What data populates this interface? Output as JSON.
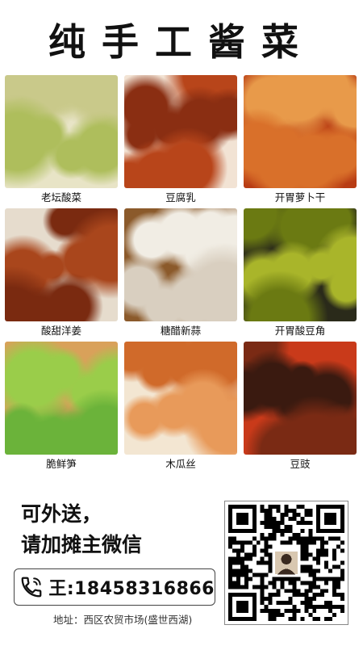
{
  "title": "纯手工酱菜",
  "items": [
    {
      "name": "老坛酸菜",
      "colors": [
        "#c9c98a",
        "#aebe5c",
        "#e8e4c6"
      ]
    },
    {
      "name": "豆腐乳",
      "colors": [
        "#8a2e12",
        "#b8451a",
        "#f2e3d4"
      ]
    },
    {
      "name": "开胃萝卜干",
      "colors": [
        "#d9702a",
        "#e89a4a",
        "#b83c14"
      ]
    },
    {
      "name": "酸甜洋姜",
      "colors": [
        "#7a2a10",
        "#a9461c",
        "#e6dccd"
      ]
    },
    {
      "name": "糖醋新蒜",
      "colors": [
        "#f1ede4",
        "#d9cfc0",
        "#8b5a2b"
      ]
    },
    {
      "name": "开胃酸豆角",
      "colors": [
        "#a9b52a",
        "#6b7a12",
        "#2a2a1a"
      ]
    },
    {
      "name": "脆鲜笋",
      "colors": [
        "#6bb33a",
        "#9acd4a",
        "#d9a15a"
      ]
    },
    {
      "name": "木瓜丝",
      "colors": [
        "#d06a2a",
        "#e89a5a",
        "#f3e6d2"
      ]
    },
    {
      "name": "豆豉",
      "colors": [
        "#3a1a10",
        "#7a2a14",
        "#c93a1a"
      ]
    }
  ],
  "contact": {
    "promo_line1": "可外送，",
    "promo_line2": "请加摊主微信",
    "phone": "王:18458316866",
    "address": "地址：西区农贸市场(盛世西湖)"
  },
  "icons": {
    "phone": "phone-icon",
    "qr": "qr-code"
  }
}
